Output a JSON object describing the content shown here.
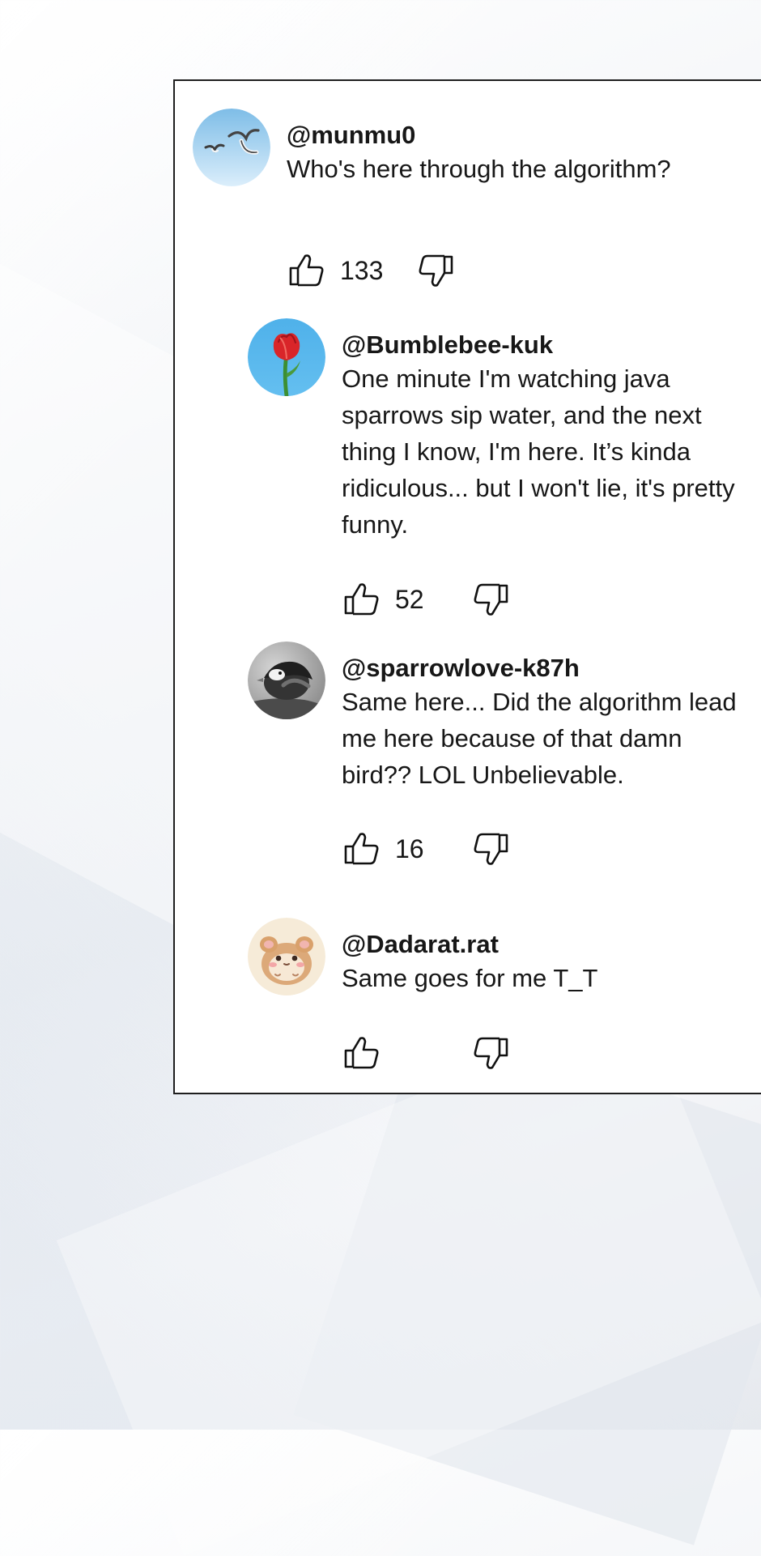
{
  "comments": [
    {
      "username": "@munmu0",
      "text": "Who's here through the algorithm?",
      "likes": "133",
      "avatar_icon": "seagull-avatar"
    },
    {
      "username": "@Bumblebee-kuk",
      "text": "One minute I'm watching java sparrows sip water, and the next thing I know, I'm here. It’s kinda ridiculous... but I won't lie, it's pretty funny.",
      "likes": "52",
      "avatar_icon": "red-tulip-avatar"
    },
    {
      "username": "@sparrowlove-k87h",
      "text": "Same here... Did the algorithm lead me here because of that damn bird?? LOL Unbelievable.",
      "likes": "16",
      "avatar_icon": "sparrow-avatar"
    },
    {
      "username": "@Dadarat.rat",
      "text": "Same goes for me T_T",
      "likes": "",
      "avatar_icon": "hamster-avatar"
    }
  ],
  "icons": {
    "like": "thumbs-up-icon",
    "dislike": "thumbs-down-icon"
  },
  "colors": {
    "panel_border": "#1e1e1e",
    "text": "#171717",
    "sky_blue": "#56b6ec",
    "tulip_red": "#d9252b"
  }
}
